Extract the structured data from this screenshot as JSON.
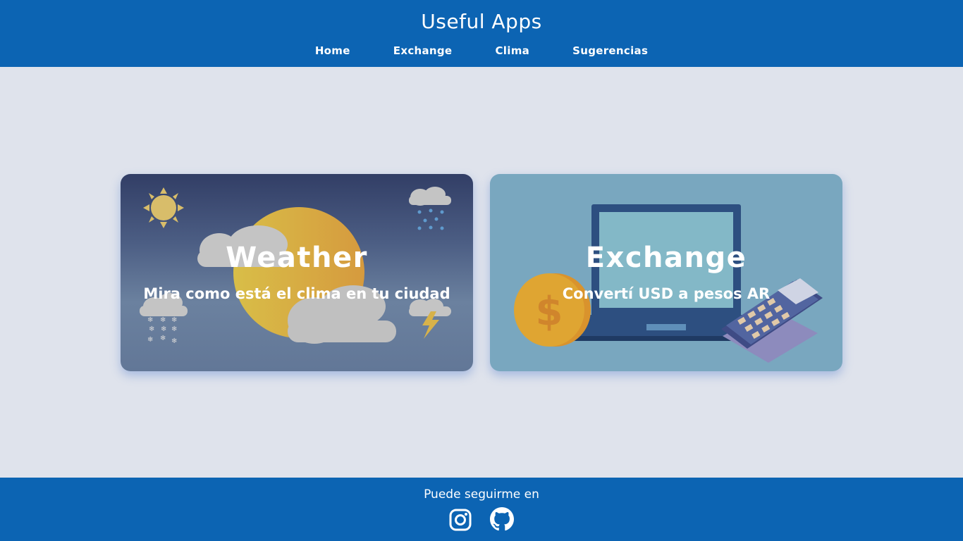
{
  "header": {
    "title": "Useful Apps",
    "nav": [
      "Home",
      "Exchange",
      "Clima",
      "Sugerencias"
    ]
  },
  "cards": [
    {
      "title": "Weather",
      "subtitle": "Mira como está el clima en tu ciudad"
    },
    {
      "title": "Exchange",
      "subtitle": "Convertí USD a pesos AR"
    }
  ],
  "footer": {
    "follow_text": "Puede seguirme en",
    "socials": [
      "instagram-icon",
      "github-icon"
    ]
  },
  "colors": {
    "header_bg": "#0c64b3",
    "page_bg": "#dfe3ec",
    "exchange_card_bg": "#79a7bf"
  }
}
